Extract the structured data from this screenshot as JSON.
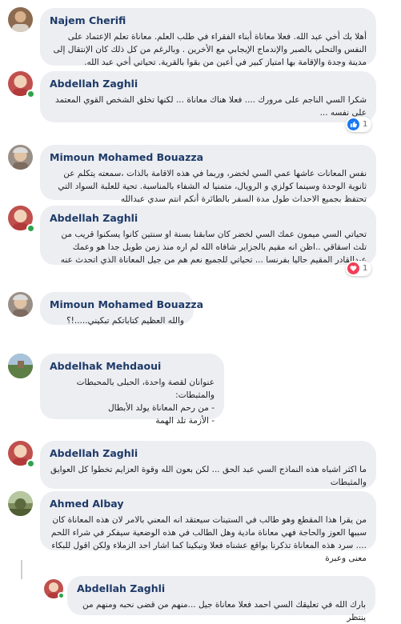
{
  "comments": [
    {
      "author": "Najem Cherifi",
      "text": "أهلا بك أخي عبد الله. فعلا معاناة أبناء الفقراء في طلب العلم. معاناة تعلم الإعتماد على النفس والتحلي بالصبر والإندماج الإيجابي مع الأخرين . وبالرغم من كل ذلك كان الإنتقال إلى مدينة وجدة والإقامة بها امتياز كبير في أعين من بقوا بالقرية. تحياتي أخي عبد الله.",
      "avatar_color": "#8c6a4f"
    },
    {
      "author": "Abdellah Zaghli",
      "text": "شكرا السي الناجم على مرورك .... فعلا هناك معاناة ... لكنها تخلق الشخص القوي المعتمد على نفسه ...",
      "reaction": "like",
      "reaction_count": "1",
      "avatar_color": "#c0504d"
    },
    {
      "author": "Mimoun Mohamed Bouazza",
      "text": "نفس المعانات عاشها عمي السي لخضر، وربما في هذه الاقامة بالذات ،سمعته يتكلم عن ثانوية الوحدة وسينما كولزي و الرويال، متمنيا له الشفاء بالمناسبة. تحية للعلبة السواد التي تحتفظ بجميع الاحداث طول مدة السفر بالطائرة أنكم انتم سدي عبدالله",
      "avatar_color": "#9a8f86"
    },
    {
      "author": "Abdellah Zaghli",
      "text": "تحياتي السي ميمون عمك السي لخضر كان سابقنا بسنة او سنتين كانوا يسكنوا قريب من تلث اسقاقي ..اظن انه مقيم بالجزاير شافاه الله لم اره منذ زمن طويل جدا هو وعمك عبدالقادر المقيم حاليا بفرنسا ... تحياتي للجميع نعم هم من جيل المعاناة الذي اتحدث عنه",
      "reaction": "heart",
      "reaction_count": "1",
      "avatar_color": "#c0504d"
    },
    {
      "author": "Mimoun Mohamed Bouazza",
      "text": "والله العظيم كتاباتكم تبكيني.....!؟",
      "avatar_color": "#9a8f86"
    },
    {
      "author": "Abdelhak Mehdaoui",
      "text": "عنوانان لقصة واحدة، الحبلى بالمحبطات والمثبطات:\n- من رحم المعاناة يولد الأبطال\n- الأزمة تلد الهمة",
      "avatar_color": "#6f8f5a"
    },
    {
      "author": "Abdellah Zaghli",
      "text": "ما اكثر اشباه هذه النماذج السي عبد الحق ... لكن بعون الله وقوة العزايم تخطوا كل العوايق والمثبطات",
      "avatar_color": "#c0504d"
    },
    {
      "author": "Ahmed Albay",
      "text": "من يقرا هذا المقطع وهو طالب في الستينات سيعتقد انه المعني بالامر لان هذه المعاناة كان سببها العوز والحاجة فهي معاناة مادية وهل الطالب في هذه الوضعية سيفكر في شراء اللحم .... سرد هذه المعاناة تذكرنا بواقع عشناه فعلا وتبكينا كما اشار احد الزملاء ولكن اقول للبكاء معنى وعبرة",
      "avatar_color": "#7d8b5c"
    },
    {
      "author": "Abdellah Zaghli",
      "text": "بارك الله في تعليقك السي احمد فعلا معاناة جيل ...منهم من قضى نحبه ومنهم من ينتظر",
      "avatar_color": "#c0504d"
    }
  ]
}
